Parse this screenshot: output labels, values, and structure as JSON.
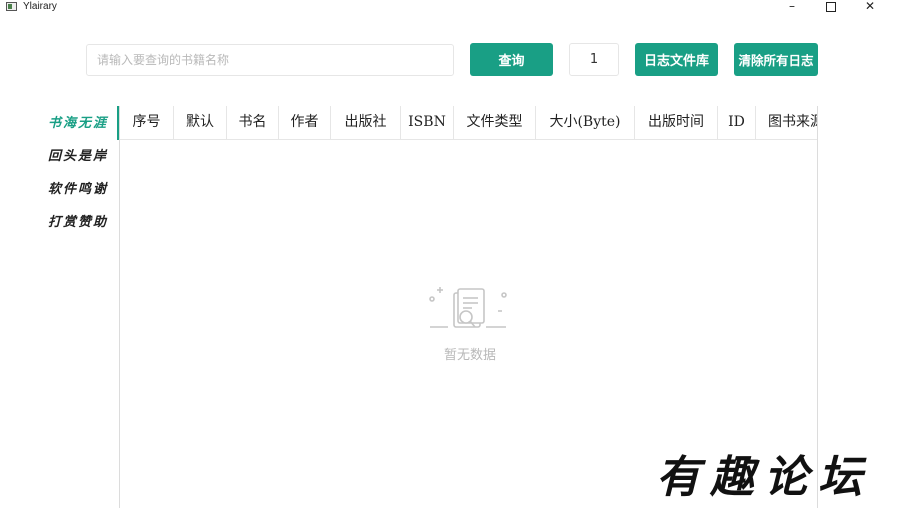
{
  "window": {
    "title": "Ylairary",
    "minimize": "–",
    "close": "✕"
  },
  "toolbar": {
    "search_placeholder": "请输入要查询的书籍名称",
    "search_value": "",
    "query_label": "查询",
    "page_value": "1",
    "logs_label": "日志文件库",
    "clear_logs_label": "清除所有日志"
  },
  "sidebar": {
    "items": [
      {
        "label": "书海无涯",
        "active": true
      },
      {
        "label": "回头是岸",
        "active": false
      },
      {
        "label": "软件鸣谢",
        "active": false
      },
      {
        "label": "打赏赞助",
        "active": false
      }
    ]
  },
  "table": {
    "columns": [
      "序号",
      "默认",
      "书名",
      "作者",
      "出版社",
      "ISBN",
      "文件类型",
      "大小(Byte)",
      "出版时间",
      "ID",
      "图书来源"
    ],
    "rows": [],
    "empty_text": "暂无数据"
  },
  "colors": {
    "accent": "#199f85",
    "border": "#e6e6e6",
    "empty_text": "#b8b8b8"
  },
  "icons": {
    "empty_state": "empty-document-search-icon",
    "app": "app-icon"
  },
  "watermark": "有趣论坛"
}
